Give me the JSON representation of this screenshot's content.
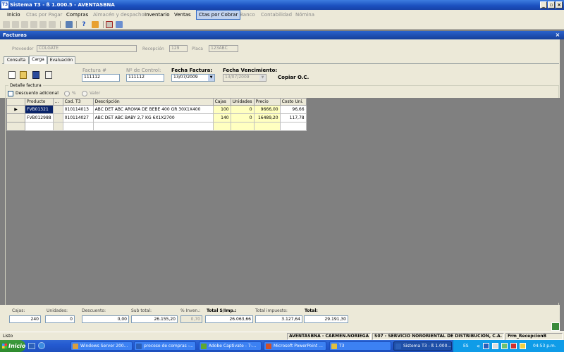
{
  "window": {
    "title": "Sistema T3 - ß 1.000.5 - AVENTASBNA",
    "icon": "T3"
  },
  "menu": [
    {
      "label": "Inicio",
      "state": "normal"
    },
    {
      "label": "Ctas por Pagar",
      "state": "disabled"
    },
    {
      "label": "Compras",
      "state": "normal"
    },
    {
      "label": "Almacén y despacho",
      "state": "disabled"
    },
    {
      "label": "Inventario",
      "state": "normal"
    },
    {
      "label": "Ventas",
      "state": "normal"
    },
    {
      "label": "Ctas por Cobrar",
      "state": "active"
    },
    {
      "label": "Banco",
      "state": "disabled"
    },
    {
      "label": "Contabilidad",
      "state": "disabled"
    },
    {
      "label": "Nómina",
      "state": "disabled"
    }
  ],
  "form": {
    "title": "Facturas",
    "proveedor_label": "Proveedor",
    "proveedor_value": "COLGATE",
    "recepcion_label": "Recepción",
    "recepcion_value": "129",
    "placa_label": "Placa",
    "placa_value": "123ABC",
    "tabs": [
      "Consulta",
      "Carga",
      "Evaluación"
    ],
    "factura_label": "Factura #",
    "factura_value": "111112",
    "control_label": "Nº de Control:",
    "control_value": "111112",
    "fecha_factura_label": "Fecha Factura:",
    "fecha_factura_value": "13/07/2009",
    "fecha_venc_label": "Fecha Vencimiento:",
    "fecha_venc_value": "13/07/2009",
    "copiar_label": "Copiar O.C.",
    "detalle_label": "Detalle factura",
    "descuento_label": "Descuento adicional",
    "pct_label": "%",
    "valor_label": "Valor"
  },
  "grid": {
    "columns": [
      "Producto",
      "...",
      "Cod. T3",
      "Descripción",
      "Cajas",
      "Unidades",
      "Precio",
      "Costo Uni."
    ],
    "rows": [
      {
        "producto": "FVB01321",
        "cod": "010114013",
        "desc": "ABC DET ABC AROMA DE BEBE 400 GR 30X1X400",
        "cajas": "100",
        "unidades": "0",
        "precio": "9666,00",
        "costo": "96,66"
      },
      {
        "producto": "FVB012988",
        "cod": "010114027",
        "desc": "ABC DET ABC BABY 2,7 KG 6X1X2700",
        "cajas": "140",
        "unidades": "0",
        "precio": "16489,20",
        "costo": "117,78"
      }
    ]
  },
  "footer": {
    "cajas_label": "Cajas:",
    "cajas_value": "240",
    "unidades_label": "Unidades:",
    "unidades_value": "0",
    "descuento_label": "Descuento:",
    "descuento_value": "0,00",
    "subtotal_label": "Sub total:",
    "subtotal_value": "26.155,20",
    "inven_label": "% Inven.:",
    "inven_value": "0,70",
    "total_simp_label": "Total S/Imp.:",
    "total_simp_value": "26.063,66",
    "impuesto_label": "Total impuesto:",
    "impuesto_value": "3.127,64",
    "total_label": "Total:",
    "total_value": "29.191,30"
  },
  "status": {
    "left": "Listo",
    "user": "AVENTASBNA - CARMEN.NORIEGA",
    "company": "S07 - SERVICIO NORORIENTAL DE DISTRIBUCIÓN, C.A.",
    "form": "Frm_RecepcionB"
  },
  "taskbar": {
    "start": "Inicio",
    "buttons": [
      {
        "label": "Windows Server 200...",
        "color": "#d8a040"
      },
      {
        "label": "proceso de compras -...",
        "color": "#2b5fb8"
      },
      {
        "label": "Adobe Captivate - 7-...",
        "color": "#5fa830"
      },
      {
        "label": "Microsoft PowerPoint ...",
        "color": "#d0502a"
      },
      {
        "label": "T3",
        "color": "#e0c040"
      },
      {
        "label": "Sistema T3 - ß 1.000...",
        "color": "#2b5fb8"
      }
    ],
    "lang": "ES",
    "time": "04:53 p.m."
  },
  "colors": {
    "accent": "#316ac5",
    "highlight": "#ffffc0",
    "selection": "#0a246a"
  }
}
